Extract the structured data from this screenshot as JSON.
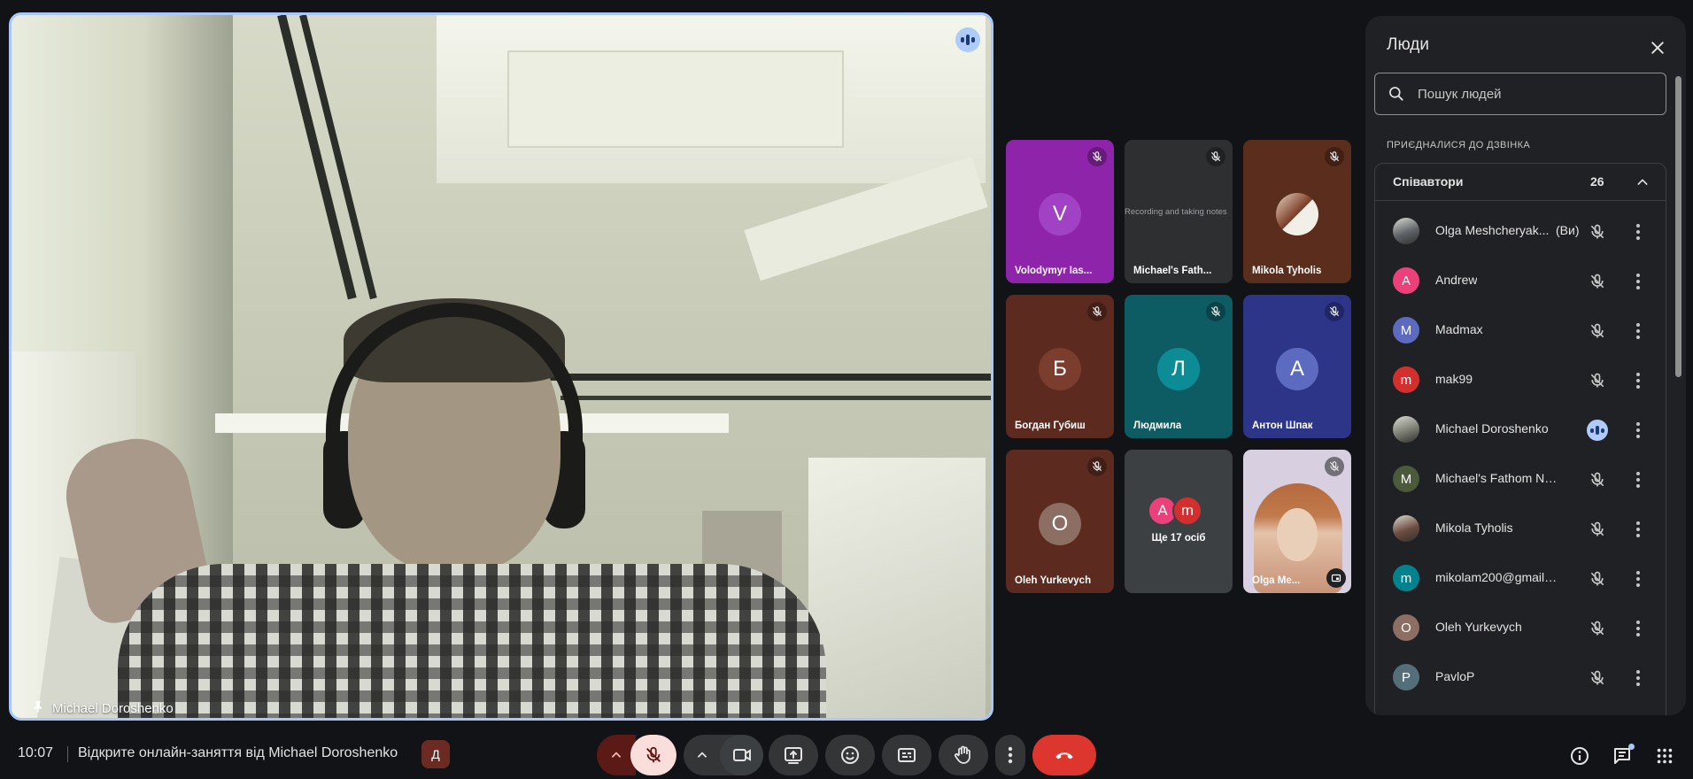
{
  "main_video": {
    "pinned_name": "Michael Doroshenko",
    "speaking": true
  },
  "tiles": [
    {
      "name": "Volodymyr Ias...",
      "avatar": "V",
      "bg": "#8e24aa",
      "avatar_bg": "#a142c4",
      "muted": true
    },
    {
      "name": "Michael's Fath...",
      "avatar": "",
      "bg": "#2d2f31",
      "avatar_bg": "",
      "muted": true,
      "screen_text": "Recording and taking notes"
    },
    {
      "name": "Mikola Tyholis",
      "avatar": "",
      "bg": "#5a2d1c",
      "avatar_bg": "#3a2a24",
      "muted": true
    },
    {
      "name": "Богдан Губиш",
      "avatar": "Б",
      "bg": "#5d2a1f",
      "avatar_bg": "#7a3d2e",
      "muted": true
    },
    {
      "name": "Людмила",
      "avatar": "Л",
      "bg": "#0d5c63",
      "avatar_bg": "#0e8c96",
      "muted": true
    },
    {
      "name": "Антон Шпак",
      "avatar": "A",
      "bg": "#2d3589",
      "avatar_bg": "#5c6bc0",
      "muted": true
    },
    {
      "name": "Oleh Yurkevych",
      "avatar": "O",
      "bg": "#5d2a1f",
      "avatar_bg": "#8d6e63",
      "muted": true
    },
    {
      "name": "Ще 17 осіб",
      "avatar": "",
      "bg": "#3c4043",
      "avatar_bg": "",
      "muted": false,
      "mini_avatars": [
        "A",
        "m"
      ]
    },
    {
      "name": "Olga Me...",
      "avatar": "",
      "bg": "#d8cfe0",
      "avatar_bg": "",
      "muted": true
    }
  ],
  "panel": {
    "title": "Люди",
    "search_placeholder": "Пошук людей",
    "joined_heading": "ПРИЄДНАЛИСЯ ДО ДЗВІНКА",
    "group_name": "Співавтори",
    "group_count": "26",
    "people": [
      {
        "name": "Olga Meshcheryak...",
        "you": "(Ви)",
        "initial": "",
        "color": "#5f6368",
        "speaking": false
      },
      {
        "name": "Andrew",
        "you": "",
        "initial": "A",
        "color": "#ec407a",
        "speaking": false
      },
      {
        "name": "Madmax",
        "you": "",
        "initial": "M",
        "color": "#5c6bc0",
        "speaking": false
      },
      {
        "name": "mak99",
        "you": "",
        "initial": "m",
        "color": "#d32f2f",
        "speaking": false
      },
      {
        "name": "Michael Doroshenko",
        "you": "",
        "initial": "",
        "color": "#7a7d72",
        "speaking": true
      },
      {
        "name": "Michael's Fathom Notet...",
        "you": "",
        "initial": "M",
        "color": "#4a5a3a",
        "speaking": false
      },
      {
        "name": "Mikola Tyholis",
        "you": "",
        "initial": "",
        "color": "#6d4c41",
        "speaking": false
      },
      {
        "name": "mikolam200@gmail.com",
        "you": "",
        "initial": "m",
        "color": "#00838f",
        "speaking": false
      },
      {
        "name": "Oleh Yurkevych",
        "you": "",
        "initial": "O",
        "color": "#8d6e63",
        "speaking": false
      },
      {
        "name": "PavloP",
        "you": "",
        "initial": "P",
        "color": "#546e7a",
        "speaking": false
      }
    ]
  },
  "bottom_bar": {
    "time": "10:07",
    "meeting_title": "Відкрите онлайн-заняття від Michael Doroshenko",
    "host_badge": "Д"
  },
  "colors": {
    "accent": "#a8c7fa",
    "mic_off_bg": "#f9dedc",
    "leave": "#dc362e"
  }
}
